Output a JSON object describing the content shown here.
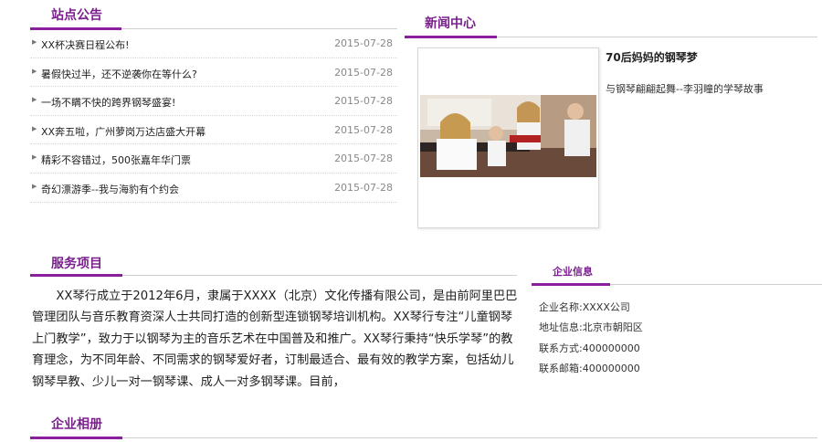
{
  "announcements": {
    "title": "站点公告",
    "items": [
      {
        "title": "XX杯决赛日程公布!",
        "date": "2015-07-28"
      },
      {
        "title": "暑假快过半，还不逆袭你在等什么?",
        "date": "2015-07-28"
      },
      {
        "title": "一场不瞒不快的跨界钢琴盛宴!",
        "date": "2015-07-28"
      },
      {
        "title": "XX奔五啦，广州萝岗万达店盛大开幕",
        "date": "2015-07-28"
      },
      {
        "title": "精彩不容错过，500张嘉年华门票",
        "date": "2015-07-28"
      },
      {
        "title": "奇幻漂游季--我与海豹有个约会",
        "date": "2015-07-28"
      }
    ]
  },
  "news": {
    "title": "新闻中心",
    "headline": "70后妈妈的钢琴梦",
    "summary": "与钢琴翩翩起舞--李羽瞳的学琴故事"
  },
  "services": {
    "title": "服务项目",
    "body": "　　XX琴行成立于2012年6月，隶属于XXXX（北京）文化传播有限公司，是由前阿里巴巴管理团队与音乐教育资深人士共同打造的创新型连锁钢琴培训机构。XX琴行专注“儿童钢琴上门教学”，致力于以钢琴为主的音乐艺术在中国普及和推广。XX琴行秉持“快乐学琴”的教育理念，为不同年龄、不同需求的钢琴爱好者，订制最适合、最有效的教学方案，包括幼儿钢琴早教、少儿一对一钢琴课、成人一对多钢琴课。目前，"
  },
  "company": {
    "title": "企业信息",
    "lines": [
      "企业名称:XXXX公司",
      "地址信息:北京市朝阳区",
      "联系方式:400000000",
      "联系邮箱:400000000"
    ]
  },
  "album": {
    "title": "企业相册"
  },
  "colors": {
    "accent": "#8a1f9c",
    "title": "#7b1e8e",
    "line": "#cfcfcf"
  }
}
